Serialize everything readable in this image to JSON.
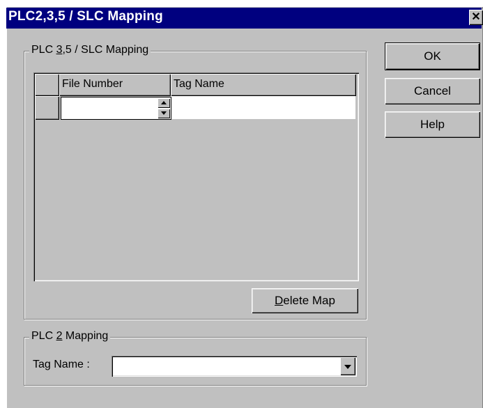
{
  "window": {
    "title": "PLC2,3,5 / SLC Mapping",
    "close_glyph": "✕"
  },
  "group_main": {
    "legend_prefix": "PLC ",
    "legend_mnemonic": "3",
    "legend_suffix": ",5 / SLC Mapping"
  },
  "grid": {
    "columns": [
      "File Number",
      "Tag Name"
    ],
    "rows": [
      {
        "file_number": "",
        "tag_name": ""
      }
    ]
  },
  "delete_button": {
    "mnemonic": "D",
    "rest": "elete Map"
  },
  "group_plc2": {
    "legend_prefix": "PLC ",
    "legend_mnemonic": "2",
    "legend_suffix": " Mapping",
    "tag_label": "Tag Name :",
    "tag_value": ""
  },
  "buttons": {
    "ok": "OK",
    "cancel": "Cancel",
    "help": "Help"
  },
  "colors": {
    "title_bar": "#00007f",
    "face": "#c0c0c0"
  }
}
